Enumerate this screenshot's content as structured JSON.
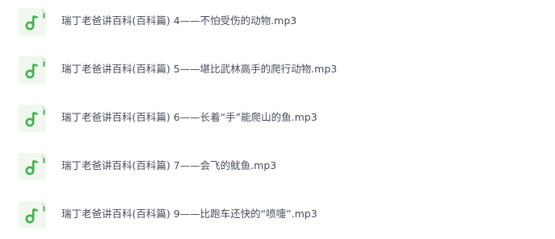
{
  "file_list": {
    "items": [
      {
        "name": "瑞丁老爸讲百科(百科篇) 4——不怕受伤的动物.mp3",
        "icon": "music-file-icon"
      },
      {
        "name": "瑞丁老爸讲百科(百科篇) 5——堪比武林高手的爬行动物.mp3",
        "icon": "music-file-icon"
      },
      {
        "name": "瑞丁老爸讲百科(百科篇) 6——长着“手”能爬山的鱼.mp3",
        "icon": "music-file-icon"
      },
      {
        "name": "瑞丁老爸讲百科(百科篇) 7——会飞的鱿鱼.mp3",
        "icon": "music-file-icon"
      },
      {
        "name": "瑞丁老爸讲百科(百科篇) 9——比跑车还快的“喷嚏”.mp3",
        "icon": "music-file-icon"
      }
    ]
  },
  "colors": {
    "icon_background": "#f1f7ee",
    "icon_fold": "#d9e9d1",
    "icon_accent": "#3fb34f",
    "file_name_text": "#454d5a"
  }
}
